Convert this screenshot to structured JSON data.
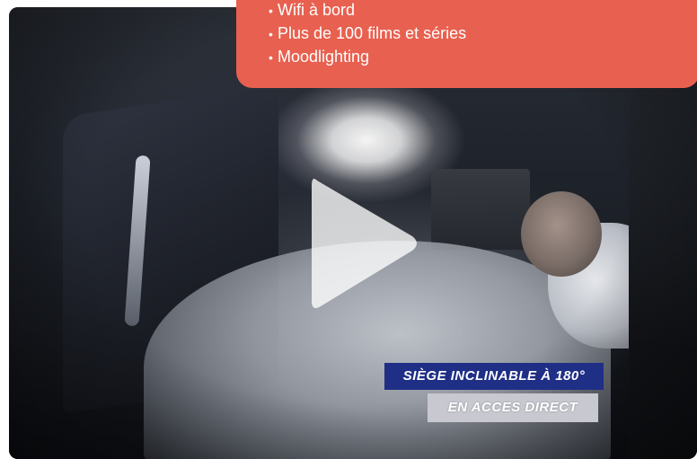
{
  "info_card": {
    "color": "#e8604f",
    "bullet": "•",
    "items": [
      "Wifi à bord",
      "Plus de 100 films et séries",
      "Moodlighting"
    ]
  },
  "video": {
    "play_icon": "play-icon",
    "captions": {
      "line1": "SIÈGE INCLINABLE À 180°",
      "line2": "EN ACCES DIRECT",
      "line1_bg": "#1f2f86",
      "line2_bg": "#c8c8d0"
    }
  }
}
